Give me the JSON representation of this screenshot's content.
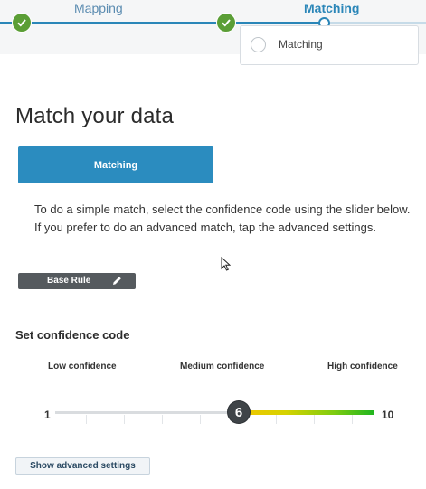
{
  "stepper": {
    "steps": [
      {
        "label": "Mapping",
        "state": "complete"
      },
      {
        "label": "Matching",
        "state": "current"
      }
    ],
    "dropdown_items": [
      {
        "label": "Matching",
        "selected": false
      }
    ],
    "colors": {
      "accent": "#2a86b8",
      "complete": "#5b9e36",
      "pending": "#c6dbe8"
    }
  },
  "main": {
    "title": "Match your data",
    "matching_box_label": "Matching",
    "description_line1": "To do a simple match, select the confidence code using the slider below.",
    "description_line2": "If you prefer to do an advanced match, tap the advanced settings.",
    "base_rule_label": "Base Rule"
  },
  "confidence": {
    "section_title": "Set confidence code",
    "labels": {
      "low": "Low confidence",
      "medium": "Medium confidence",
      "high": "High confidence"
    },
    "slider": {
      "min": 1,
      "max": 10,
      "value": 6
    }
  },
  "actions": {
    "advanced_settings_label": "Show advanced settings"
  }
}
